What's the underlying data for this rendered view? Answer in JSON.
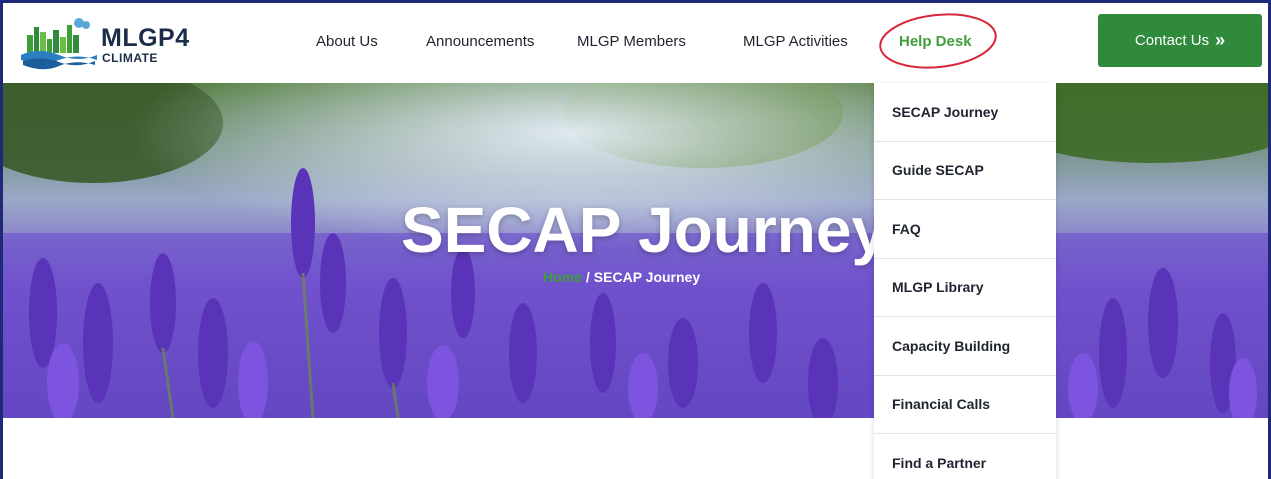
{
  "logo": {
    "title": "MLGP4",
    "subtitle": "CLIMATE"
  },
  "nav": {
    "items": [
      "About Us",
      "Announcements",
      "MLGP Members",
      "MLGP Activities",
      "Help Desk"
    ],
    "active": "Help Desk"
  },
  "contact": {
    "label": "Contact Us",
    "arrow": "»"
  },
  "hero": {
    "title": "SECAP Journey",
    "breadcrumb_home": "Home",
    "breadcrumb_sep": "/",
    "breadcrumb_current": "SECAP Journey"
  },
  "dropdown": {
    "items": [
      "SECAP Journey",
      "Guide SECAP",
      "FAQ",
      "MLGP Library",
      "Capacity Building",
      "Financial Calls",
      "Find a Partner"
    ]
  },
  "colors": {
    "accent_green": "#3f9e3a",
    "button_green": "#2f8a3b",
    "annotation_red": "#d8263a",
    "frame_blue": "#1e2a78"
  },
  "icons": {
    "contact_arrow": "double-chevron-right-icon",
    "logo": "city-skyline-logo-icon"
  }
}
